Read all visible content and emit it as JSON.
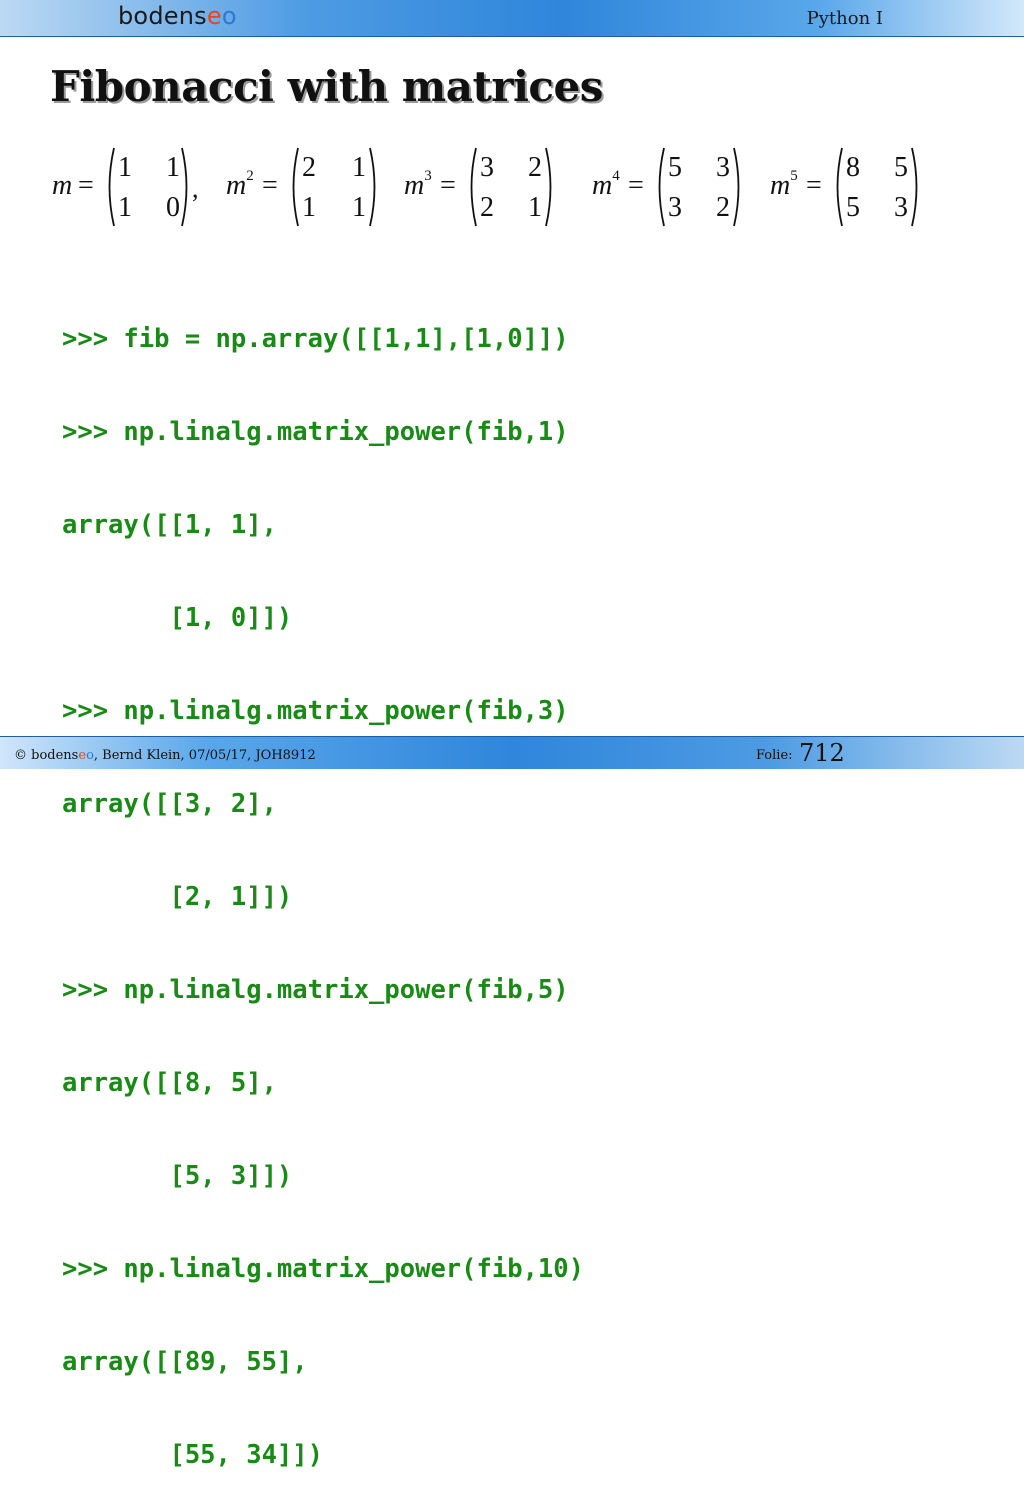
{
  "header": {
    "logo": {
      "part1": "bodens",
      "part2": "e",
      "part3": "o"
    },
    "course": "Python I"
  },
  "slide": {
    "title": "Fibonacci with matrices"
  },
  "equations": [
    {
      "var": "m",
      "exp": "",
      "cells": [
        "1",
        "1",
        "1",
        "0"
      ],
      "trail": ","
    },
    {
      "var": "m",
      "exp": "2",
      "cells": [
        "2",
        "1",
        "1",
        "1"
      ],
      "trail": ""
    },
    {
      "var": "m",
      "exp": "3",
      "cells": [
        "3",
        "2",
        "2",
        "1"
      ],
      "trail": ""
    },
    {
      "var": "m",
      "exp": "4",
      "cells": [
        "5",
        "3",
        "3",
        "2"
      ],
      "trail": ""
    },
    {
      "var": "m",
      "exp": "5",
      "cells": [
        "8",
        "5",
        "5",
        "3"
      ],
      "trail": ""
    }
  ],
  "code_lines": [
    ">>> fib = np.array([[1,1],[1,0]])",
    ">>> np.linalg.matrix_power(fib,1)",
    "array([[1, 1],",
    "       [1, 0]])",
    ">>> np.linalg.matrix_power(fib,3)",
    "array([[3, 2],",
    "       [2, 1]])",
    ">>> np.linalg.matrix_power(fib,5)",
    "array([[8, 5],",
    "       [5, 3]])",
    ">>> np.linalg.matrix_power(fib,10)",
    "array([[89, 55],",
    "       [55, 34]])"
  ],
  "footer": {
    "copyright": "© ",
    "brand1": "bodens",
    "brand2": "e",
    "brand3": "o",
    "rest": ", Bernd Klein, 07/05/17, JOH8912",
    "folie_label": "Folie:",
    "folie_number": "712"
  },
  "colors": {
    "code": "#1a8a17",
    "bar": "#2f86db",
    "accent_red": "#e8451f",
    "accent_blue": "#2b7ad0"
  }
}
